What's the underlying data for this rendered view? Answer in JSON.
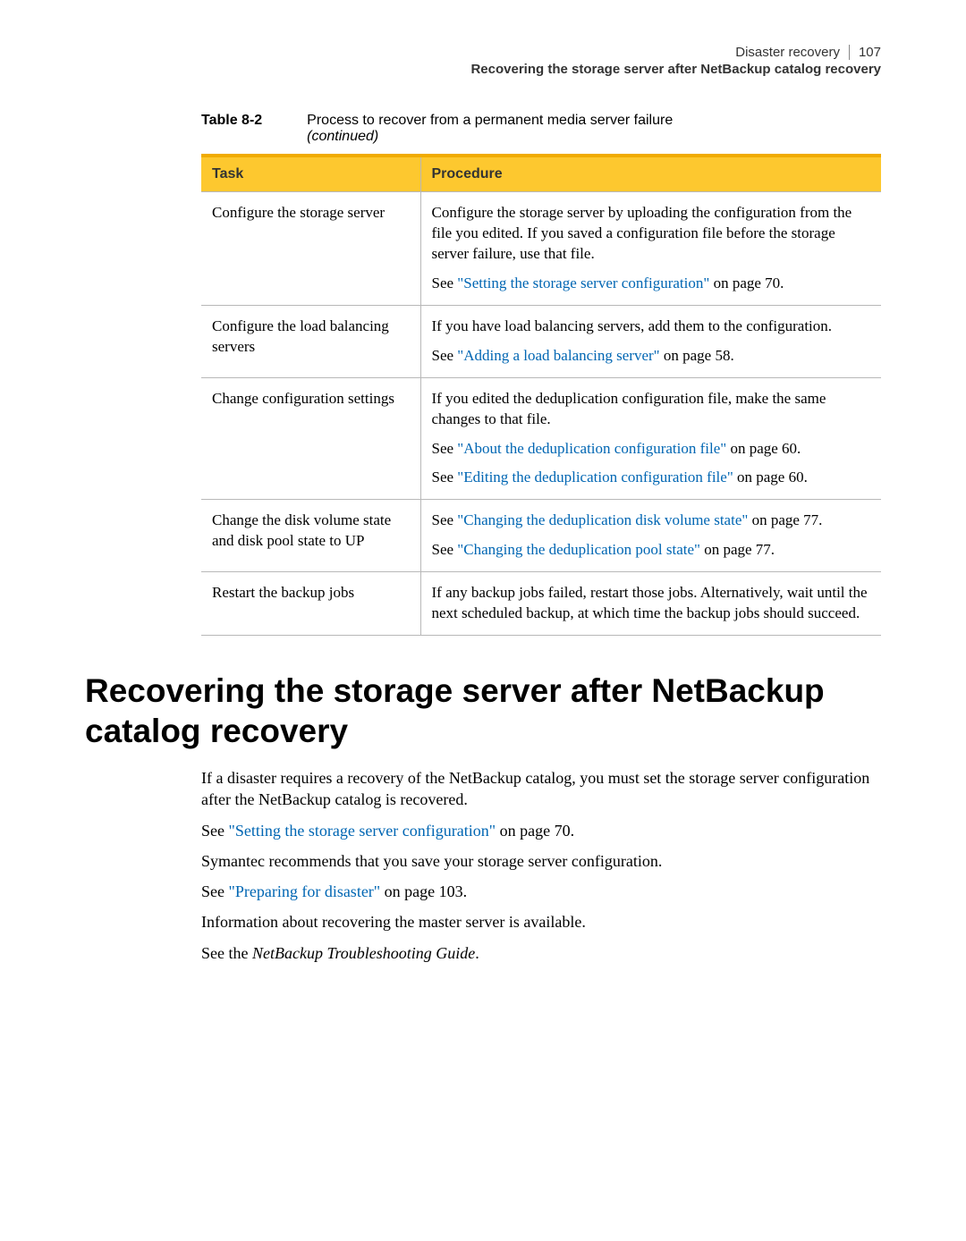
{
  "header": {
    "chapter": "Disaster recovery",
    "page_number": "107",
    "section": "Recovering the storage server after NetBackup catalog recovery"
  },
  "table": {
    "caption_num": "Table 8-2",
    "caption_title": "Process to recover from a permanent media server failure",
    "caption_cont": "(continued)",
    "headers": {
      "task": "Task",
      "procedure": "Procedure"
    },
    "rows": [
      {
        "task": "Configure the storage server",
        "p1": "Configure the storage server by uploading the configuration from the file you edited. If you saved a configuration file before the storage server failure, use that file.",
        "p2_pre": "See ",
        "p2_link": "\"Setting the storage server configuration\"",
        "p2_post": " on page 70."
      },
      {
        "task": "Configure the load balancing servers",
        "p1": "If you have load balancing servers, add them to the configuration.",
        "p2_pre": "See ",
        "p2_link": "\"Adding a load balancing server\"",
        "p2_post": " on page 58."
      },
      {
        "task": "Change configuration settings",
        "p1": "If you edited the deduplication configuration file, make the same changes to that file.",
        "p2_pre": "See ",
        "p2_link": "\"About the deduplication configuration file\"",
        "p2_post": " on page 60.",
        "p3_pre": "See ",
        "p3_link": "\"Editing the deduplication configuration file\"",
        "p3_post": " on page 60."
      },
      {
        "task": "Change the disk volume state and disk pool state to UP",
        "p1_pre": "See ",
        "p1_link": "\"Changing the deduplication disk volume state\"",
        "p1_post": " on page 77.",
        "p2_pre": "See ",
        "p2_link": "\"Changing the deduplication pool state\"",
        "p2_post": " on page 77."
      },
      {
        "task": "Restart the backup jobs",
        "p1": "If any backup jobs failed, restart those jobs. Alternatively, wait until the next scheduled backup, at which time the backup jobs should succeed."
      }
    ]
  },
  "section_head": "Recovering the storage server after NetBackup catalog recovery",
  "body": {
    "p1": "If a disaster requires a recovery of the NetBackup catalog, you must set the storage server configuration after the NetBackup catalog is recovered.",
    "p2_pre": "See ",
    "p2_link": "\"Setting the storage server configuration\"",
    "p2_post": " on page 70.",
    "p3": "Symantec recommends that you save your storage server configuration.",
    "p4_pre": "See ",
    "p4_link": "\"Preparing for disaster\"",
    "p4_post": " on page 103.",
    "p5": "Information about recovering the master server is available.",
    "p6_pre": "See the ",
    "p6_em": "NetBackup Troubleshooting Guide",
    "p6_post": "."
  }
}
